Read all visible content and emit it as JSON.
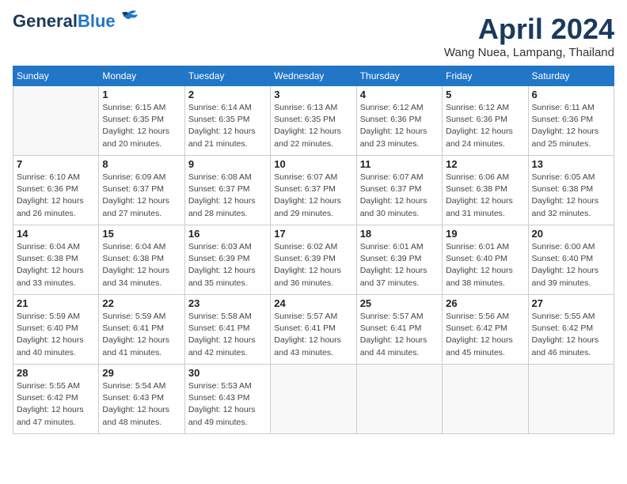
{
  "header": {
    "logo_line1": "General",
    "logo_line2": "Blue",
    "month_title": "April 2024",
    "location": "Wang Nuea, Lampang, Thailand"
  },
  "weekdays": [
    "Sunday",
    "Monday",
    "Tuesday",
    "Wednesday",
    "Thursday",
    "Friday",
    "Saturday"
  ],
  "weeks": [
    [
      {
        "day": "",
        "info": ""
      },
      {
        "day": "1",
        "info": "Sunrise: 6:15 AM\nSunset: 6:35 PM\nDaylight: 12 hours\nand 20 minutes."
      },
      {
        "day": "2",
        "info": "Sunrise: 6:14 AM\nSunset: 6:35 PM\nDaylight: 12 hours\nand 21 minutes."
      },
      {
        "day": "3",
        "info": "Sunrise: 6:13 AM\nSunset: 6:35 PM\nDaylight: 12 hours\nand 22 minutes."
      },
      {
        "day": "4",
        "info": "Sunrise: 6:12 AM\nSunset: 6:36 PM\nDaylight: 12 hours\nand 23 minutes."
      },
      {
        "day": "5",
        "info": "Sunrise: 6:12 AM\nSunset: 6:36 PM\nDaylight: 12 hours\nand 24 minutes."
      },
      {
        "day": "6",
        "info": "Sunrise: 6:11 AM\nSunset: 6:36 PM\nDaylight: 12 hours\nand 25 minutes."
      }
    ],
    [
      {
        "day": "7",
        "info": "Sunrise: 6:10 AM\nSunset: 6:36 PM\nDaylight: 12 hours\nand 26 minutes."
      },
      {
        "day": "8",
        "info": "Sunrise: 6:09 AM\nSunset: 6:37 PM\nDaylight: 12 hours\nand 27 minutes."
      },
      {
        "day": "9",
        "info": "Sunrise: 6:08 AM\nSunset: 6:37 PM\nDaylight: 12 hours\nand 28 minutes."
      },
      {
        "day": "10",
        "info": "Sunrise: 6:07 AM\nSunset: 6:37 PM\nDaylight: 12 hours\nand 29 minutes."
      },
      {
        "day": "11",
        "info": "Sunrise: 6:07 AM\nSunset: 6:37 PM\nDaylight: 12 hours\nand 30 minutes."
      },
      {
        "day": "12",
        "info": "Sunrise: 6:06 AM\nSunset: 6:38 PM\nDaylight: 12 hours\nand 31 minutes."
      },
      {
        "day": "13",
        "info": "Sunrise: 6:05 AM\nSunset: 6:38 PM\nDaylight: 12 hours\nand 32 minutes."
      }
    ],
    [
      {
        "day": "14",
        "info": "Sunrise: 6:04 AM\nSunset: 6:38 PM\nDaylight: 12 hours\nand 33 minutes."
      },
      {
        "day": "15",
        "info": "Sunrise: 6:04 AM\nSunset: 6:38 PM\nDaylight: 12 hours\nand 34 minutes."
      },
      {
        "day": "16",
        "info": "Sunrise: 6:03 AM\nSunset: 6:39 PM\nDaylight: 12 hours\nand 35 minutes."
      },
      {
        "day": "17",
        "info": "Sunrise: 6:02 AM\nSunset: 6:39 PM\nDaylight: 12 hours\nand 36 minutes."
      },
      {
        "day": "18",
        "info": "Sunrise: 6:01 AM\nSunset: 6:39 PM\nDaylight: 12 hours\nand 37 minutes."
      },
      {
        "day": "19",
        "info": "Sunrise: 6:01 AM\nSunset: 6:40 PM\nDaylight: 12 hours\nand 38 minutes."
      },
      {
        "day": "20",
        "info": "Sunrise: 6:00 AM\nSunset: 6:40 PM\nDaylight: 12 hours\nand 39 minutes."
      }
    ],
    [
      {
        "day": "21",
        "info": "Sunrise: 5:59 AM\nSunset: 6:40 PM\nDaylight: 12 hours\nand 40 minutes."
      },
      {
        "day": "22",
        "info": "Sunrise: 5:59 AM\nSunset: 6:41 PM\nDaylight: 12 hours\nand 41 minutes."
      },
      {
        "day": "23",
        "info": "Sunrise: 5:58 AM\nSunset: 6:41 PM\nDaylight: 12 hours\nand 42 minutes."
      },
      {
        "day": "24",
        "info": "Sunrise: 5:57 AM\nSunset: 6:41 PM\nDaylight: 12 hours\nand 43 minutes."
      },
      {
        "day": "25",
        "info": "Sunrise: 5:57 AM\nSunset: 6:41 PM\nDaylight: 12 hours\nand 44 minutes."
      },
      {
        "day": "26",
        "info": "Sunrise: 5:56 AM\nSunset: 6:42 PM\nDaylight: 12 hours\nand 45 minutes."
      },
      {
        "day": "27",
        "info": "Sunrise: 5:55 AM\nSunset: 6:42 PM\nDaylight: 12 hours\nand 46 minutes."
      }
    ],
    [
      {
        "day": "28",
        "info": "Sunrise: 5:55 AM\nSunset: 6:42 PM\nDaylight: 12 hours\nand 47 minutes."
      },
      {
        "day": "29",
        "info": "Sunrise: 5:54 AM\nSunset: 6:43 PM\nDaylight: 12 hours\nand 48 minutes."
      },
      {
        "day": "30",
        "info": "Sunrise: 5:53 AM\nSunset: 6:43 PM\nDaylight: 12 hours\nand 49 minutes."
      },
      {
        "day": "",
        "info": ""
      },
      {
        "day": "",
        "info": ""
      },
      {
        "day": "",
        "info": ""
      },
      {
        "day": "",
        "info": ""
      }
    ]
  ]
}
